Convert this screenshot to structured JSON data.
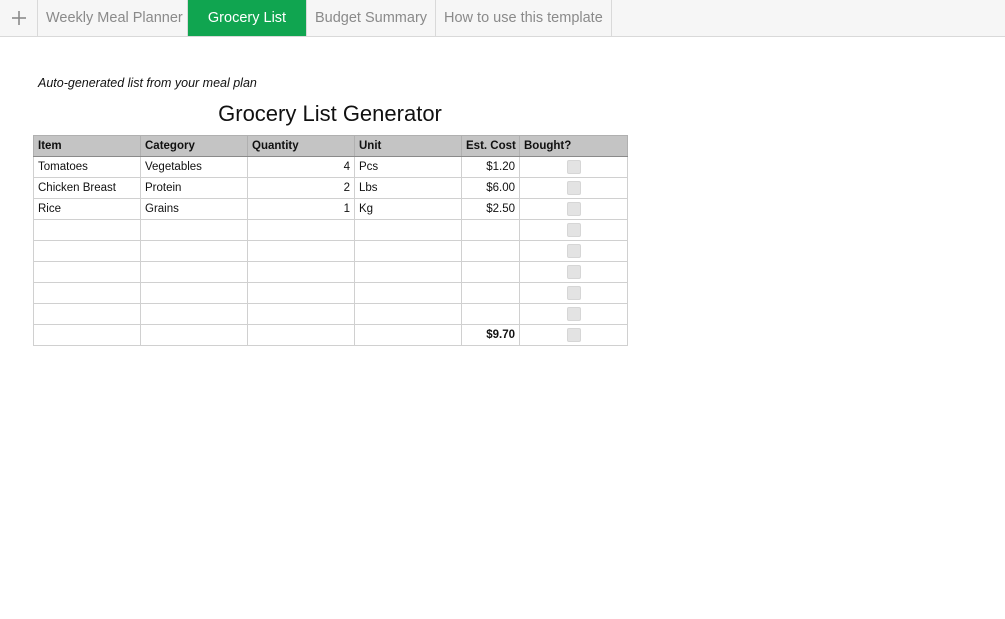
{
  "tabs": {
    "add_icon": "plus-icon",
    "items": [
      {
        "label": "Weekly Meal Planner",
        "active": false
      },
      {
        "label": "Grocery List",
        "active": true
      },
      {
        "label": "Budget Summary",
        "active": false
      },
      {
        "label": "How to use this template",
        "active": false
      }
    ],
    "active_color": "#10a550"
  },
  "sheet": {
    "subtitle": "Auto-generated list from your meal plan",
    "title": "Grocery List Generator",
    "columns": [
      "Item",
      "Category",
      "Quantity",
      "Unit",
      "Est. Cost",
      "Bought?"
    ],
    "rows": [
      {
        "item": "Tomatoes",
        "category": "Vegetables",
        "quantity": "4",
        "unit": "Pcs",
        "cost": "$1.20",
        "bought": false
      },
      {
        "item": "Chicken Breast",
        "category": "Protein",
        "quantity": "2",
        "unit": "Lbs",
        "cost": "$6.00",
        "bought": false
      },
      {
        "item": "Rice",
        "category": "Grains",
        "quantity": "1",
        "unit": "Kg",
        "cost": "$2.50",
        "bought": false
      },
      {
        "item": "",
        "category": "",
        "quantity": "",
        "unit": "",
        "cost": "",
        "bought": false
      },
      {
        "item": "",
        "category": "",
        "quantity": "",
        "unit": "",
        "cost": "",
        "bought": false
      },
      {
        "item": "",
        "category": "",
        "quantity": "",
        "unit": "",
        "cost": "",
        "bought": false
      },
      {
        "item": "",
        "category": "",
        "quantity": "",
        "unit": "",
        "cost": "",
        "bought": false
      },
      {
        "item": "",
        "category": "",
        "quantity": "",
        "unit": "",
        "cost": "",
        "bought": false
      }
    ],
    "total": "$9.70"
  }
}
